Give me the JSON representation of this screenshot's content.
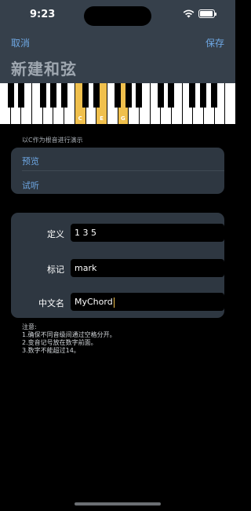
{
  "status_bar": {
    "time": "9:23",
    "battery_level": 0.95
  },
  "nav": {
    "cancel_label": "取消",
    "save_label": "保存",
    "title": "新建和弦"
  },
  "keyboard": {
    "white_keys": [
      {
        "note": "",
        "highlighted": false
      },
      {
        "note": "",
        "highlighted": false
      },
      {
        "note": "",
        "highlighted": false
      },
      {
        "note": "",
        "highlighted": false
      },
      {
        "note": "",
        "highlighted": false
      },
      {
        "note": "",
        "highlighted": false
      },
      {
        "note": "",
        "highlighted": false
      },
      {
        "note": "C",
        "highlighted": true
      },
      {
        "note": "",
        "highlighted": false
      },
      {
        "note": "E",
        "highlighted": true
      },
      {
        "note": "",
        "highlighted": false
      },
      {
        "note": "G",
        "highlighted": true
      },
      {
        "note": "",
        "highlighted": false
      },
      {
        "note": "",
        "highlighted": false
      },
      {
        "note": "",
        "highlighted": false
      },
      {
        "note": "",
        "highlighted": false
      },
      {
        "note": "",
        "highlighted": false
      },
      {
        "note": "",
        "highlighted": false
      },
      {
        "note": "",
        "highlighted": false
      },
      {
        "note": "",
        "highlighted": false
      },
      {
        "note": "",
        "highlighted": false
      },
      {
        "note": "",
        "highlighted": false
      }
    ],
    "highlight_color": "#f0c04d"
  },
  "demo_section": {
    "label": "以C作为根音进行演示",
    "preview_label": "预览",
    "audition_label": "试听"
  },
  "form": {
    "definition": {
      "label": "定义",
      "value": "1 3 5"
    },
    "mark": {
      "label": "标记",
      "value": "mark"
    },
    "chinese_name": {
      "label": "中文名",
      "value": "MyChord"
    }
  },
  "notes": {
    "title": "注意:",
    "line1": "1.确保不同音级间通过空格分开。",
    "line2": "2.变音记号放在数字前面。",
    "line3": "3.数字不能超过14。"
  },
  "colors": {
    "accent": "#6ea7e3",
    "header_bg": "#36404b",
    "card_bg": "#2e3741"
  }
}
